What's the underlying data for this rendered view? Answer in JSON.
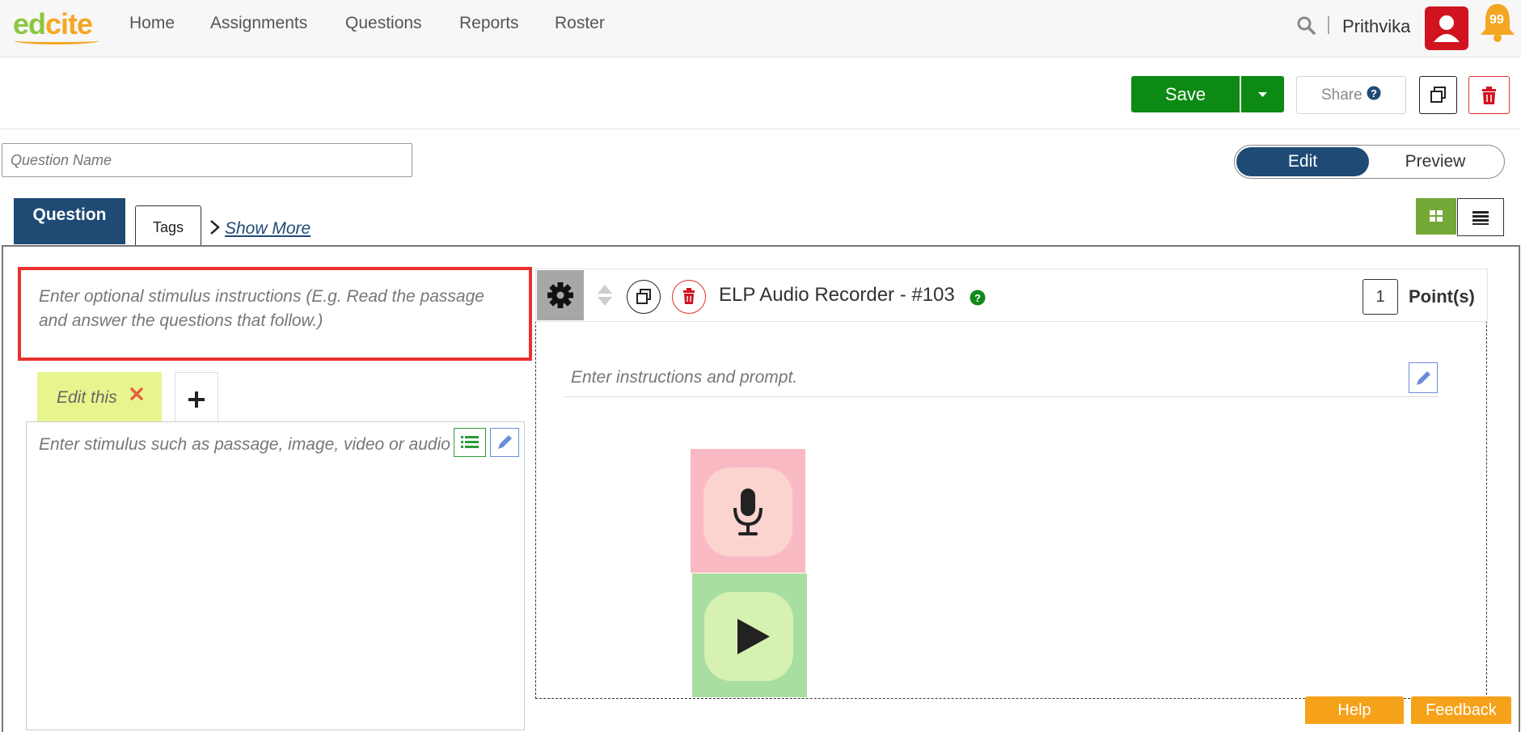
{
  "brand": {
    "logo_part1": "ed",
    "logo_part2": "cite"
  },
  "nav": {
    "items": [
      "Home",
      "Assignments",
      "Questions",
      "Reports",
      "Roster"
    ],
    "username": "Prithvika",
    "notification_count": "99"
  },
  "toolbar": {
    "save_label": "Save",
    "share_label": "Share"
  },
  "question_name": {
    "placeholder": "Question Name",
    "value": ""
  },
  "mode": {
    "edit_label": "Edit",
    "preview_label": "Preview",
    "active": "Edit"
  },
  "tabs": {
    "question_label": "Question",
    "tags_label": "Tags",
    "show_more_label": "Show More"
  },
  "stimulus": {
    "instructions_placeholder": "Enter optional stimulus instructions (E.g. Read the passage and answer the questions that follow.)",
    "tab_label": "Edit this",
    "body_placeholder": "Enter stimulus such as passage, image, video or audio clip"
  },
  "widget": {
    "title": "ELP Audio Recorder - #103",
    "points_value": "1",
    "points_label": "Point(s)",
    "prompt_placeholder": "Enter instructions and prompt."
  },
  "footer": {
    "help_label": "Help",
    "feedback_label": "Feedback"
  },
  "colors": {
    "brand_green": "#8cc63f",
    "brand_orange": "#f5a623",
    "save_green": "#0c8a13",
    "navy": "#1e4a74",
    "danger_red": "#e0302e",
    "record_pink": "#f9b9c3",
    "play_green": "#a9dea1"
  },
  "icons": [
    "search-icon",
    "avatar-icon",
    "bell-icon",
    "caret-down-icon",
    "help-circle-icon",
    "copy-icon",
    "trash-icon",
    "chevron-right-icon",
    "grid-icon",
    "list-icon",
    "close-icon",
    "plus-icon",
    "list-lines-icon",
    "pencil-icon",
    "gear-icon",
    "sort-icon",
    "microphone-icon",
    "play-icon"
  ]
}
